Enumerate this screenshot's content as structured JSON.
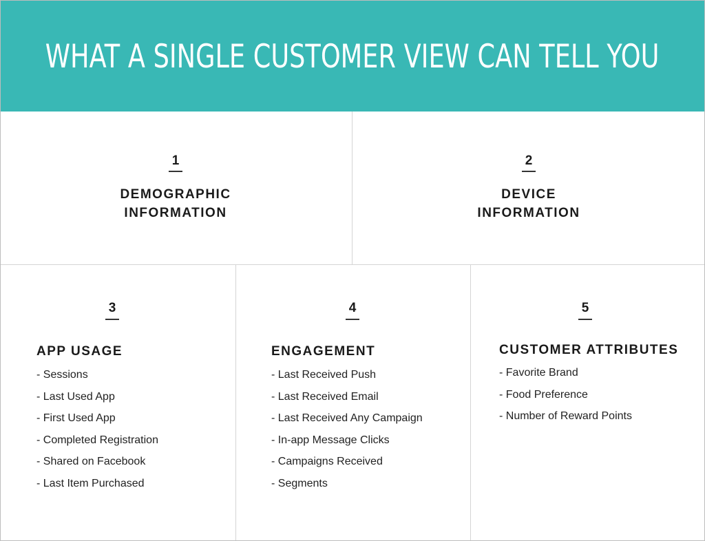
{
  "header": {
    "title": "WHAT A SINGLE CUSTOMER VIEW CAN TELL YOU",
    "background_color": "#39b8b5"
  },
  "sections": [
    {
      "number": "1",
      "title_lines": [
        "DEMOGRAPHIC",
        "INFORMATION"
      ],
      "items": []
    },
    {
      "number": "2",
      "title_lines": [
        "DEVICE",
        "INFORMATION"
      ],
      "items": []
    },
    {
      "number": "3",
      "title": "APP USAGE",
      "items": [
        "- Sessions",
        "- Last Used App",
        "- First Used App",
        "- Completed Registration",
        "- Shared on Facebook",
        "- Last Item Purchased"
      ]
    },
    {
      "number": "4",
      "title": "ENGAGEMENT",
      "items": [
        "- Last Received Push",
        "- Last Received Email",
        "- Last Received Any Campaign",
        "- In-app Message Clicks",
        "- Campaigns Received",
        "- Segments"
      ]
    },
    {
      "number": "5",
      "title": "CUSTOMER ATTRIBUTES",
      "items": [
        "- Favorite Brand",
        "- Food Preference",
        "- Number of Reward Points"
      ]
    }
  ]
}
